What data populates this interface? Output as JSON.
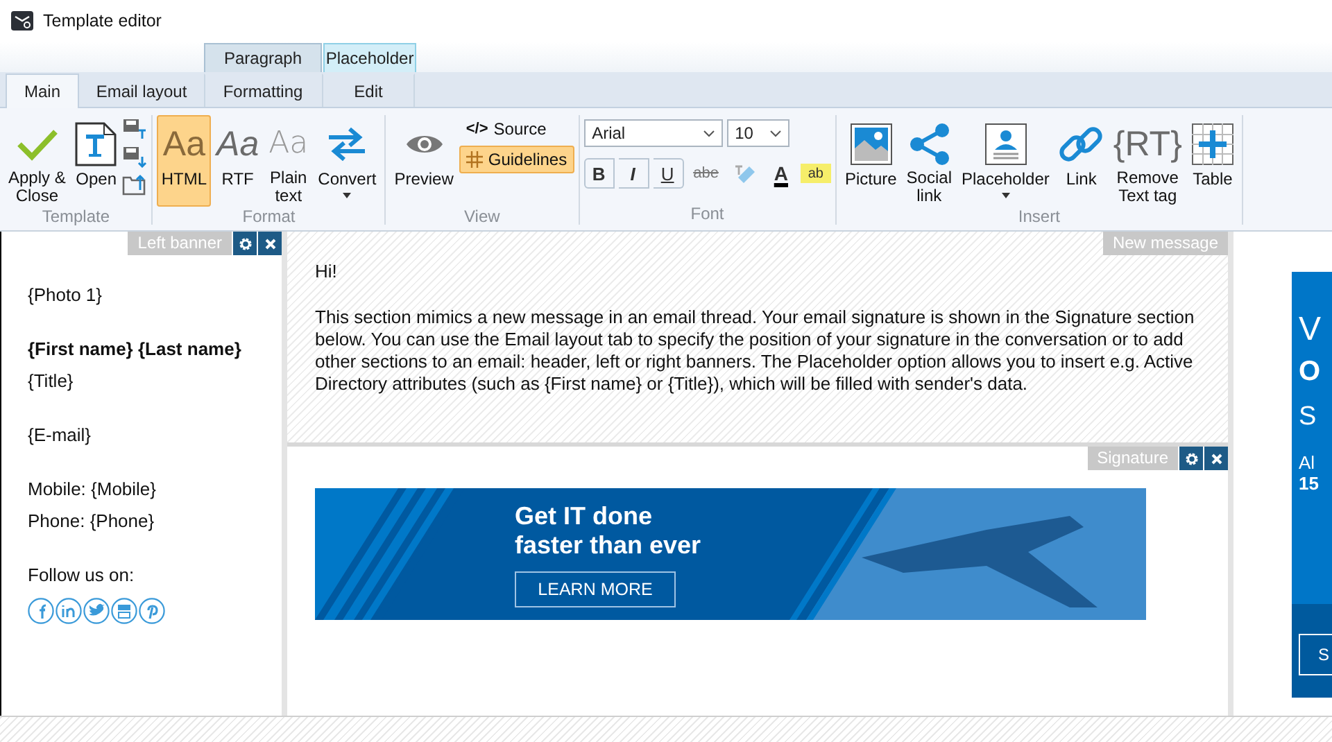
{
  "window": {
    "title": "Template editor"
  },
  "context_tabs": [
    {
      "label": "Paragraph",
      "color": "#d5e2ec"
    },
    {
      "label": "Placeholder",
      "color": "#d3eef8"
    }
  ],
  "tabs": [
    {
      "label": "Main",
      "selected": true
    },
    {
      "label": "Email layout",
      "selected": false
    },
    {
      "label": "Formatting",
      "selected": false
    },
    {
      "label": "Edit",
      "selected": false
    }
  ],
  "ribbon": {
    "groups": [
      {
        "kind": "buttons",
        "label": "Template",
        "items": [
          {
            "kind": "large",
            "label": "Apply &\nClose"
          },
          {
            "kind": "large",
            "label": "Open"
          },
          {
            "kind": "icon_stack"
          }
        ]
      },
      {
        "kind": "buttons",
        "label": "Format",
        "items": [
          {
            "kind": "large",
            "label": "HTML",
            "icon_text": "Aa",
            "selected": true
          },
          {
            "kind": "large",
            "label": "RTF",
            "icon_text": "Aa",
            "selected": false
          },
          {
            "kind": "large",
            "label": "Plain\ntext",
            "icon_text": "Aa",
            "selected": false
          },
          {
            "kind": "large",
            "label": "Convert",
            "dropdown": true
          }
        ]
      },
      {
        "kind": "buttons",
        "label": "View",
        "items": [
          {
            "kind": "large",
            "label": "Preview"
          },
          {
            "kind": "small",
            "icon_text": "</>",
            "label": "Source",
            "selected": false
          },
          {
            "kind": "small",
            "label": "Guidelines",
            "selected": true
          }
        ]
      },
      {
        "kind": "font",
        "label": "Font",
        "font": "Arial",
        "size": "10",
        "format_buttons": [
          {
            "kind": "bold",
            "label": "B"
          },
          {
            "kind": "italic",
            "label": "I"
          },
          {
            "kind": "underline",
            "label": "U"
          },
          {
            "kind": "strike",
            "label": "abe"
          },
          {
            "kind": "clear"
          },
          {
            "kind": "color",
            "label": "A"
          },
          {
            "kind": "highlight",
            "label": "ab"
          }
        ]
      },
      {
        "kind": "buttons",
        "label": "Insert",
        "items": [
          {
            "kind": "large",
            "label": "Picture"
          },
          {
            "kind": "large",
            "label": "Social\nlink"
          },
          {
            "kind": "large",
            "label": "Placeholder",
            "dropdown": true
          },
          {
            "kind": "large",
            "label": "Link"
          },
          {
            "kind": "large",
            "label": "Remove\nText tag",
            "icon_text": "{RT}"
          },
          {
            "kind": "large",
            "label": "Table"
          }
        ]
      }
    ]
  },
  "left_banner": {
    "title": "Left banner",
    "blocks": [
      [
        {
          "text": "{Photo 1}",
          "bold": false
        }
      ],
      [
        {
          "text": "{First name} {Last name}",
          "bold": true
        },
        {
          "text": "{Title}",
          "bold": false
        }
      ],
      [
        {
          "text": "{E-mail}",
          "bold": false
        }
      ],
      [
        {
          "text": "Mobile: {Mobile}",
          "bold": false
        },
        {
          "text": "Phone: {Phone}",
          "bold": false
        }
      ],
      [
        {
          "text": "Follow us on:",
          "bold": false
        }
      ]
    ]
  },
  "new_message": {
    "title": "New message",
    "greeting": "Hi!",
    "body": "This section mimics a new message in an email thread. Your email signature is shown in the Signature section below. You can use the Email layout tab to specify the position of your signature in the conversation or to add other sections to an email: header, left or right banners. The Placeholder option allows you to insert e.g. Active Directory attributes (such as {First name} or {Title}), which will be filled with sender's data."
  },
  "signature": {
    "title": "Signature",
    "banner": {
      "headline": "Get IT done\nfaster than ever",
      "button": "LEARN MORE"
    }
  },
  "right_banner": {
    "lines": [
      "V",
      "O",
      "S",
      "Al",
      "15"
    ],
    "button": "S"
  }
}
